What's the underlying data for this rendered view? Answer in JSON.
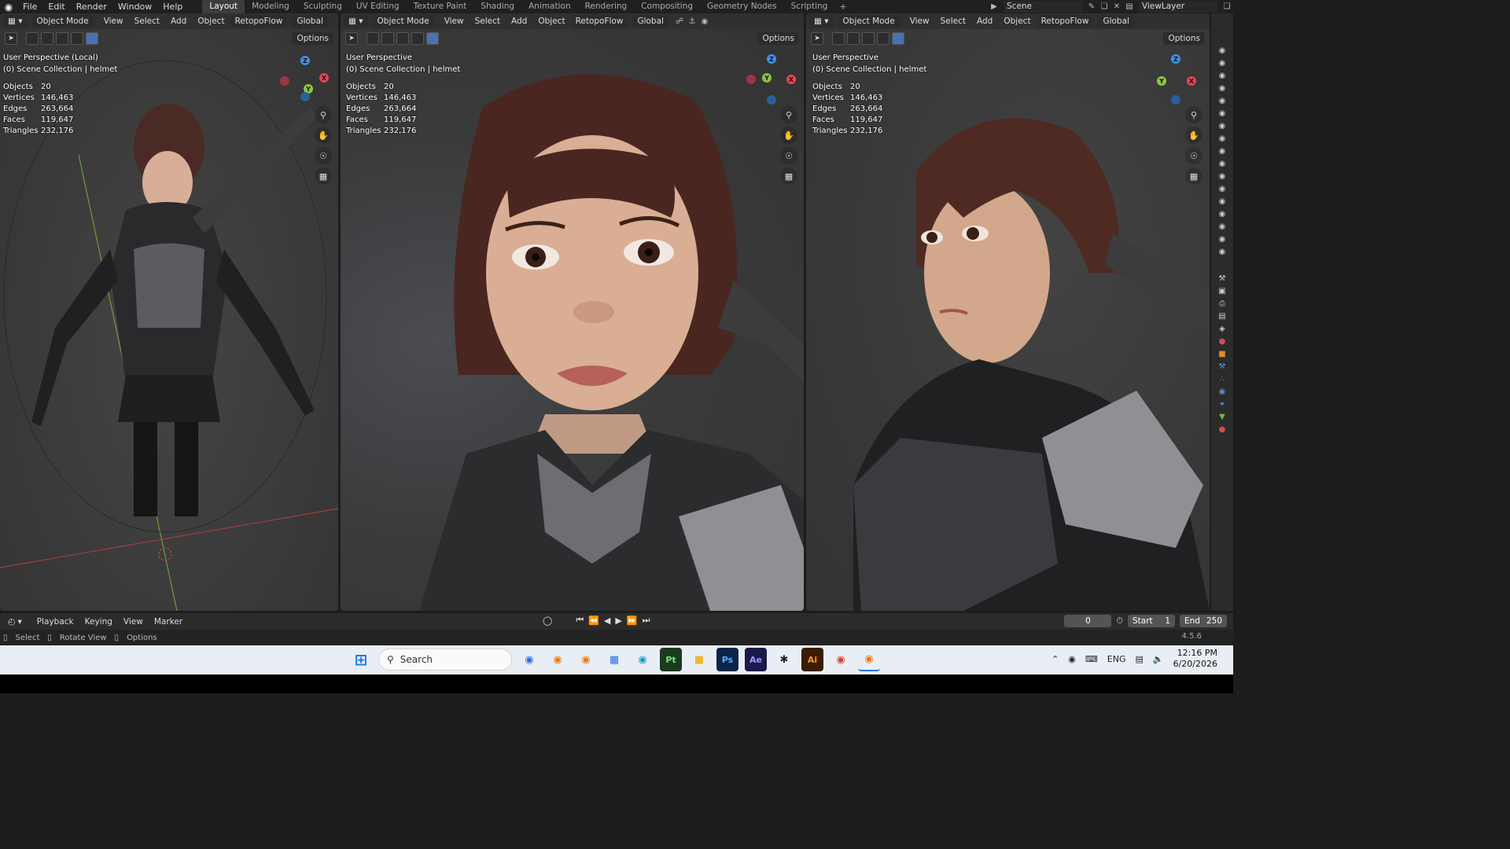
{
  "menu": [
    "File",
    "Edit",
    "Render",
    "Window",
    "Help"
  ],
  "workspaces": [
    "Layout",
    "Modeling",
    "Sculpting",
    "UV Editing",
    "Texture Paint",
    "Shading",
    "Animation",
    "Rendering",
    "Compositing",
    "Geometry Nodes",
    "Scripting"
  ],
  "active_workspace": "Layout",
  "scene_name": "Scene",
  "view_layer": "ViewLayer",
  "viewports": [
    {
      "mode": "Object Mode",
      "menus": [
        "View",
        "Select",
        "Add",
        "Object"
      ],
      "addon": "RetopoFlow",
      "orientation": "Global",
      "options": "Options",
      "title": "User Perspective (Local)",
      "collection": "(0) Scene Collection | helmet",
      "stats": [
        [
          "Objects",
          "20"
        ],
        [
          "Vertices",
          "146,463"
        ],
        [
          "Edges",
          "263,664"
        ],
        [
          "Faces",
          "119,647"
        ],
        [
          "Triangles",
          "232,176"
        ]
      ]
    },
    {
      "mode": "Object Mode",
      "menus": [
        "View",
        "Select",
        "Add",
        "Object"
      ],
      "addon": "RetopoFlow",
      "orientation": "Global",
      "options": "Options",
      "title": "User Perspective",
      "collection": "(0) Scene Collection | helmet",
      "stats": [
        [
          "Objects",
          "20"
        ],
        [
          "Vertices",
          "146,463"
        ],
        [
          "Edges",
          "263,664"
        ],
        [
          "Faces",
          "119,647"
        ],
        [
          "Triangles",
          "232,176"
        ]
      ]
    },
    {
      "mode": "Object Mode",
      "menus": [
        "View",
        "Select",
        "Add",
        "Object"
      ],
      "addon": "RetopoFlow",
      "orientation": "Global",
      "options": "Options",
      "title": "User Perspective",
      "collection": "(0) Scene Collection | helmet",
      "stats": [
        [
          "Objects",
          "20"
        ],
        [
          "Vertices",
          "146,463"
        ],
        [
          "Edges",
          "263,664"
        ],
        [
          "Faces",
          "119,647"
        ],
        [
          "Triangles",
          "232,176"
        ]
      ]
    }
  ],
  "gizmo": {
    "x": "X",
    "y": "Y",
    "z": "Z",
    "x_color": "#e84357",
    "y_color": "#8cc640",
    "z_color": "#3f8fe8"
  },
  "timeline": {
    "menus": [
      "Playback",
      "Keying",
      "View",
      "Marker"
    ],
    "current_frame": "0",
    "start_label": "Start",
    "start": "1",
    "end_label": "End",
    "end": "250"
  },
  "statusbar": {
    "select": "Select",
    "rotate": "Rotate View",
    "options": "Options",
    "version": "4.5.6"
  },
  "taskbar": {
    "search_placeholder": "Search",
    "language": "ENG",
    "time": "12:16 PM",
    "date": "6/20/2026"
  },
  "colors": {
    "accent": "#4772b3",
    "viewport_bg": "#3a3a3a",
    "header_bg": "#303030"
  }
}
